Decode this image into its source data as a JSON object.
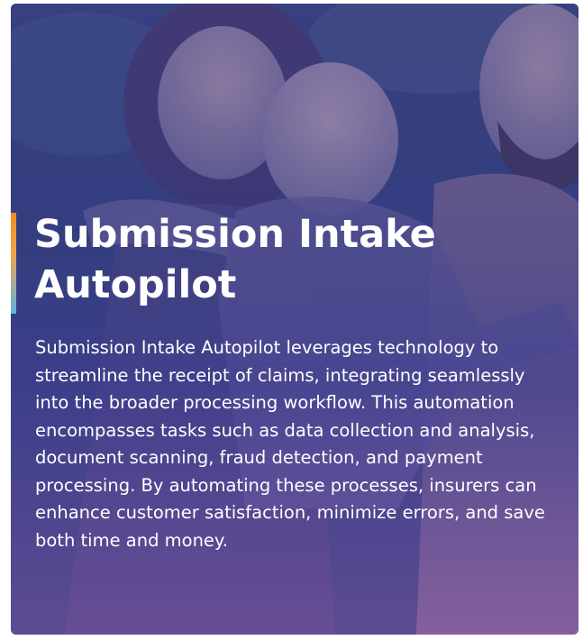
{
  "card": {
    "title": "Submission Intake Autopilot",
    "description": "Submission Intake Autopilot leverages technology to streamline the receipt of claims, integrating seamlessly into the broader processing workflow. This automation encompasses tasks such as data collection and analysis, document scanning, fraud detection, and payment processing. By automating these processes, insurers can enhance customer satisfaction, minimize errors, and save both time and money."
  },
  "colors": {
    "overlay_top": "#3d3f86",
    "overlay_bottom": "#b0689d",
    "accent_orange": "#f28a22",
    "accent_blue": "#5fb2e3",
    "text": "#ffffff"
  }
}
